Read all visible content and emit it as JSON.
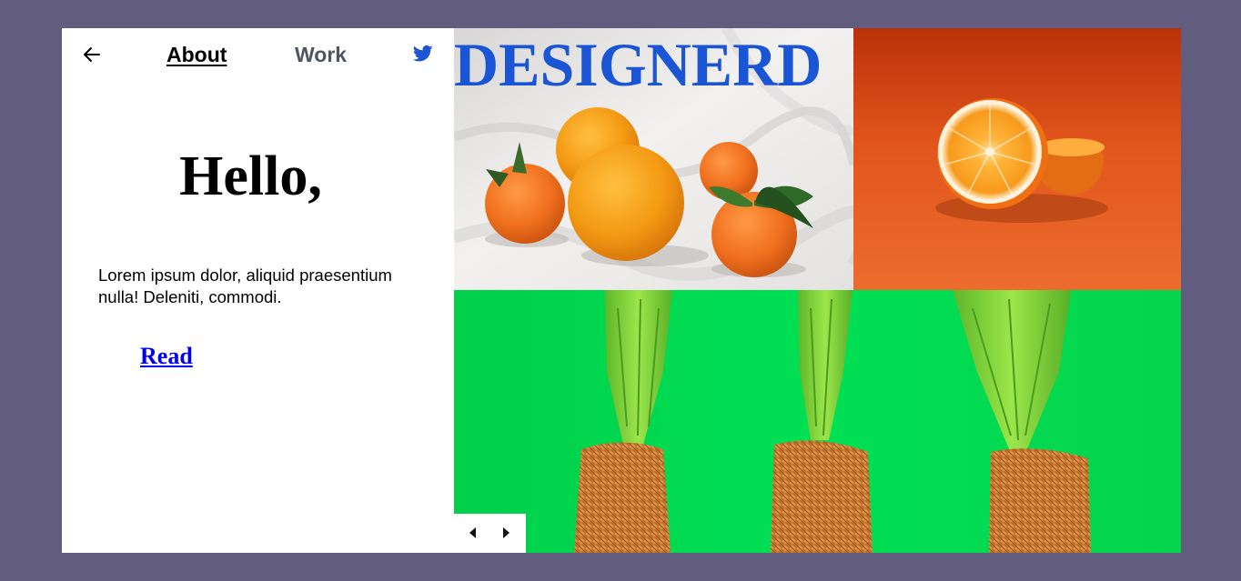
{
  "nav": {
    "back_icon": "arrow-left-icon",
    "about_label": "About",
    "work_label": "Work",
    "twitter_icon": "twitter-icon"
  },
  "hero": {
    "heading": "Hello,",
    "body": "Lorem ipsum dolor, aliquid praesentium nulla! Deleniti, commodi.",
    "cta_label": "Read"
  },
  "gallery": {
    "brand": "DESIGNERD",
    "prev_icon": "caret-left-icon",
    "next_icon": "caret-right-icon"
  },
  "colors": {
    "background": "#625c7e",
    "brand": "#1a55d6",
    "link": "#0000ee",
    "twitter": "#1a55d6"
  }
}
